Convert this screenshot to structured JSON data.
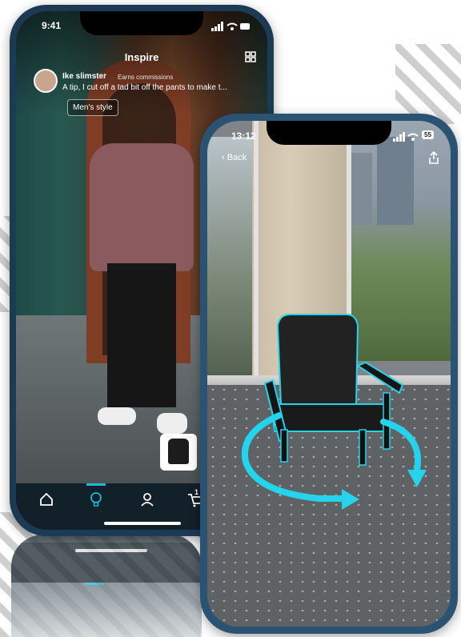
{
  "left_phone": {
    "time": "9:41",
    "header_title": "Inspire",
    "post": {
      "author": "Ike slimster",
      "badge": "Earns commissions",
      "caption": "A tip, I cut off a tad bit off the pants to make t...",
      "tag": "Men's style"
    },
    "tabbar": {
      "items": [
        {
          "icon": "home-icon"
        },
        {
          "icon": "lightbulb-icon",
          "active": true
        },
        {
          "icon": "person-icon"
        },
        {
          "icon": "cart-icon"
        }
      ],
      "cart_count": "1",
      "accent": "#1fb6d1"
    }
  },
  "right_phone": {
    "time": "13:12",
    "back_label": "Back",
    "battery": "55"
  },
  "colors": {
    "accent_ring": "#23d4ec",
    "tabbar_bg": "#12202a",
    "frame": "#1d3a55"
  }
}
